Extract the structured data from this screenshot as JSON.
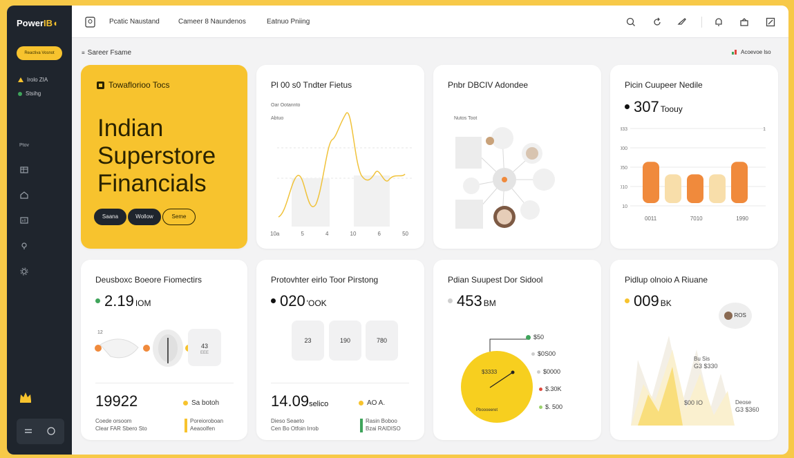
{
  "app": {
    "logo_main": "Power",
    "logo_accent": "IB",
    "sidebar_pill": "Reactiva Vosnot"
  },
  "sidebar": {
    "legend": [
      {
        "label": "Irolo ZIA",
        "marker": "triangle",
        "color": "#f7c32e"
      },
      {
        "label": "Stsihg",
        "marker": "dot",
        "color": "#3fa45b"
      }
    ],
    "section_label": "Ptov",
    "icons": [
      "table-icon",
      "home-icon",
      "grid-icon",
      "location-icon",
      "settings-icon"
    ],
    "bottom_icons": [
      "layers-icon",
      "circle-icon"
    ]
  },
  "topbar": {
    "menu": [
      "Pcatic Naustand",
      "Cameer 8 Naundenos",
      "Eatnuo Pniing"
    ],
    "icons": [
      "search-icon",
      "refresh-icon",
      "comment-icon",
      "bell-icon",
      "basket-icon",
      "edit-icon"
    ]
  },
  "breadcrumb": "Sareer Fsame",
  "add_visual": "Acoevoe lso",
  "hero": {
    "tag": "Towaflorioo Tocs",
    "title_lines": [
      "Indian",
      "Superstore",
      "Financials"
    ],
    "buttons": [
      "Saana",
      "Wollow",
      "Seme"
    ]
  },
  "card_trend": {
    "title": "Pl 00 s0 Tndter Fietus",
    "sub1": "Oar Ootannto",
    "sub2": "Abtuo",
    "ticks": [
      "10a",
      "5",
      "4",
      "10",
      "6",
      "50"
    ]
  },
  "card_network": {
    "title": "Pnbr DBCIV Adondee",
    "caption": "Nutos Toot"
  },
  "card_customer": {
    "title": "Picin Cuupeer Nedile",
    "kpi": "307",
    "unit": "Toouy",
    "y_ticks": [
      "3333",
      "4000",
      "2050",
      "1010",
      "10"
    ],
    "x_labels": [
      "0011",
      "7010",
      "1990"
    ],
    "bar_colors": [
      "#f08a3c",
      "#f8deaa",
      "#f08a3c",
      "#f8deaa",
      "#f08a3c"
    ],
    "bar_levels": [
      0.86,
      0.6,
      0.6,
      0.6,
      0.86
    ]
  },
  "card_dist": {
    "title": "Deusboxc Boeore Fiomectirs",
    "kpi": "2.19",
    "unit": "IOM",
    "label_top": "12",
    "tile_value": "43",
    "tile_sub": "EEE",
    "footer_num": "19922",
    "footer_tag": "Sa botoh",
    "footer_lines": [
      "Coede orsoom",
      "Clear FAR Sbero Sto"
    ],
    "footer_right": [
      "Poreioroboan",
      "Aeaoolfen"
    ]
  },
  "card_prod": {
    "title": "Protovhter eirlo Toor Pirstong",
    "kpi": "020",
    "unit": "'OOK",
    "tiles": [
      "23",
      "190",
      "780"
    ],
    "footer_num": "14.09",
    "footer_unit": "selico",
    "footer_tag": "AO A.",
    "footer_lines": [
      "Dieso Seaeto",
      "Cen Bo Otfoin Irrob"
    ],
    "footer_right": [
      "Rasin Boboo",
      "Bzai RAIDISO"
    ]
  },
  "card_pie": {
    "title": "Pdian Suupest Dor Sidool",
    "kpi": "453",
    "unit": "BM",
    "center_label": "$3333",
    "bottom_label": "Pboooeeret",
    "legend": [
      {
        "label": "$50",
        "color": "#3fa45b"
      },
      {
        "label": "$0S00",
        "color": "#cccccc"
      },
      {
        "label": "$0000",
        "color": "#cccccc"
      },
      {
        "label": "$.30K",
        "color": "#e0473c"
      },
      {
        "label": "$. 500",
        "color": "#9bd36b"
      }
    ]
  },
  "card_area": {
    "title": "Pidlup olnoio A Riuane",
    "kpi": "009",
    "unit": "BK",
    "bubble": "ROS",
    "labels": [
      {
        "small": "Bu Sis",
        "big": "G3 $330"
      },
      {
        "small": "",
        "big": "$00 IO"
      },
      {
        "small": "Deose",
        "big": "G3 $360"
      }
    ]
  }
}
